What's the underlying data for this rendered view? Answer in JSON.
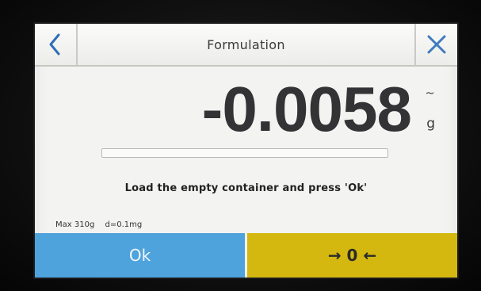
{
  "header": {
    "title": "Formulation",
    "back_icon": "chevron-left-icon",
    "close_icon": "close-icon",
    "icon_color": "#2f6fb5"
  },
  "reading": {
    "value": "-0.0058",
    "unit": "g",
    "stability_mark": "~"
  },
  "progress": {
    "fraction": 0.0
  },
  "message": "Load the empty container and press 'Ok'",
  "specs": {
    "max": "Max 310g",
    "d": "d=0.1mg"
  },
  "footer": {
    "ok_label": "Ok",
    "zero_label": "→ 0 ←",
    "ok_color": "#4ea3dc",
    "zero_color": "#d4b80f"
  }
}
